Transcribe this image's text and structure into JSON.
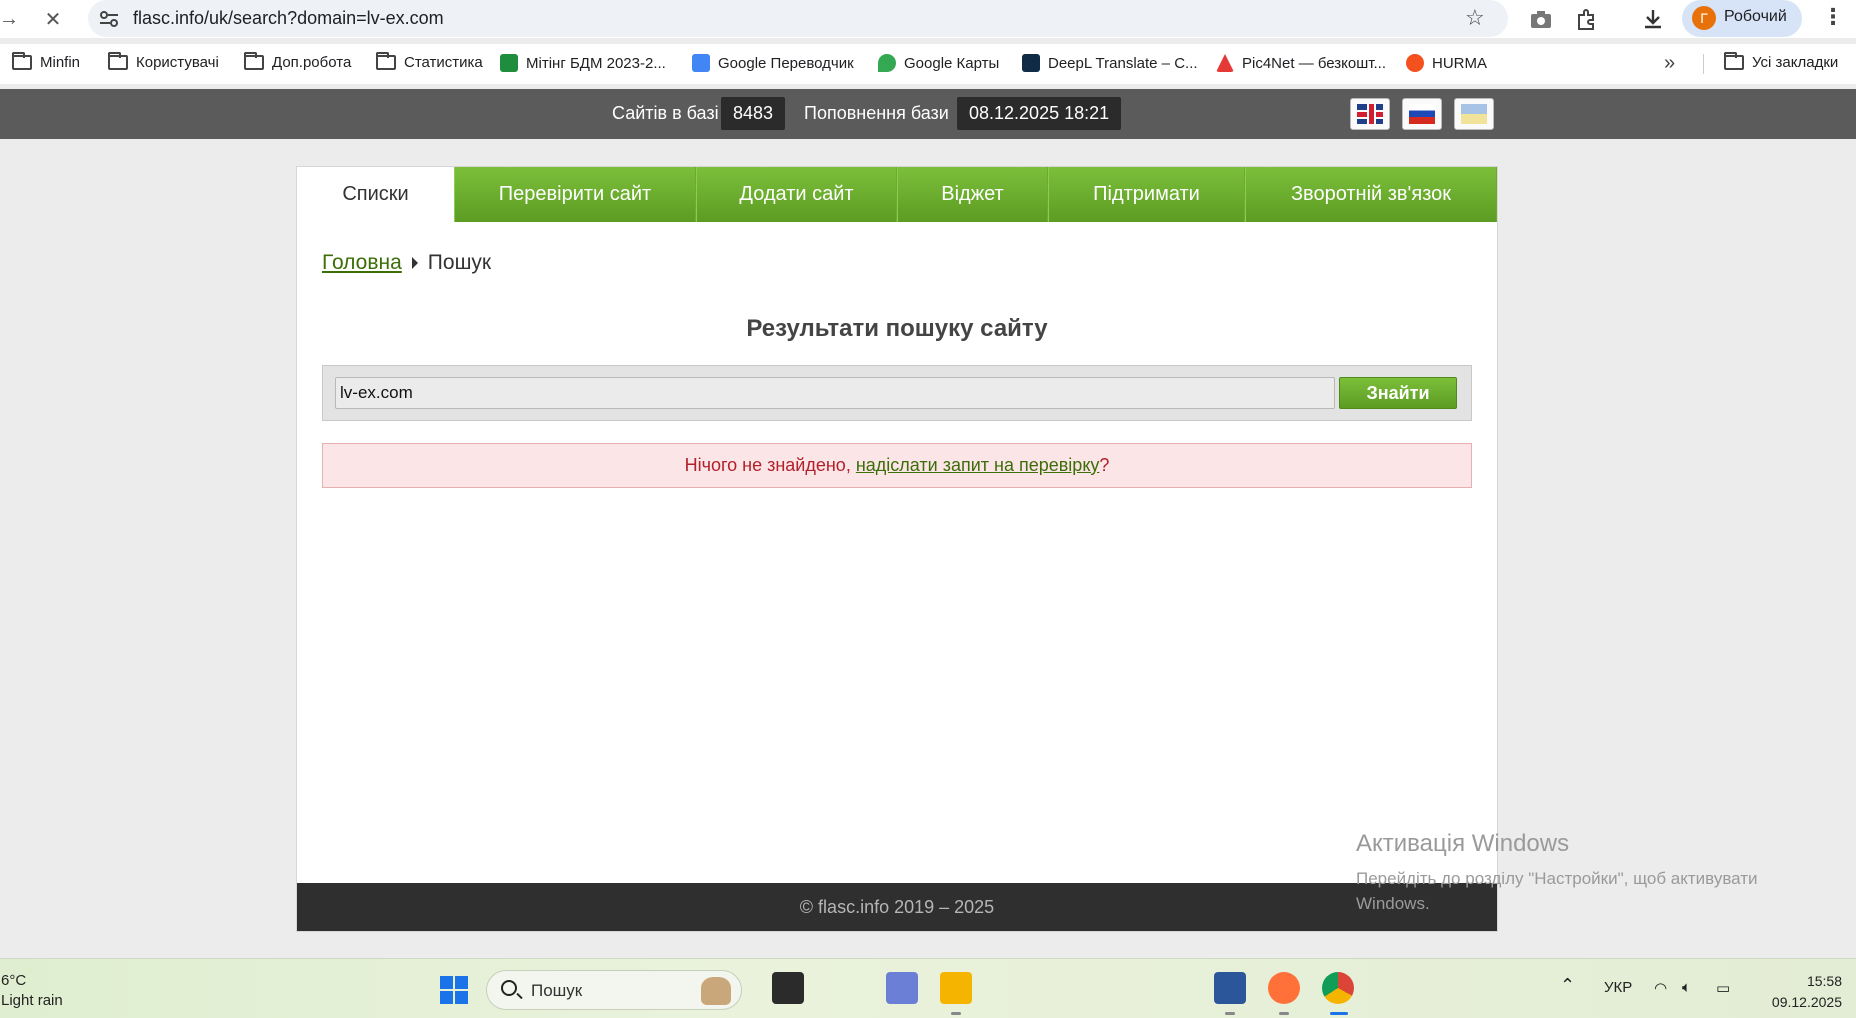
{
  "browser": {
    "url": "flasc.info/uk/search?domain=lv-ex.com",
    "profile_initial": "Г",
    "profile_name": "Робочий",
    "bookmarks": [
      {
        "label": "Minfin",
        "icon": "folder-icon"
      },
      {
        "label": "Користувачі",
        "icon": "folder-icon"
      },
      {
        "label": "Доп.робота",
        "icon": "folder-icon"
      },
      {
        "label": "Статистика",
        "icon": "folder-icon"
      },
      {
        "label": "Мітінг БДМ 2023-2...",
        "icon": "sheets-icon"
      },
      {
        "label": "Google Переводчик",
        "icon": "translate-icon"
      },
      {
        "label": "Google Карты",
        "icon": "maps-icon"
      },
      {
        "label": "DeepL Translate – С...",
        "icon": "deepl-icon"
      },
      {
        "label": "Pic4Net — безкошт...",
        "icon": "pic4net-icon"
      },
      {
        "label": "HURMA",
        "icon": "hurma-icon"
      }
    ],
    "all_bookmarks": "Усі закладки"
  },
  "site": {
    "stats": {
      "sites_label": "Сайтів в базі",
      "sites_count": "8483",
      "update_label": "Поповнення бази",
      "update_date": "08.12.2025 18:21"
    },
    "tabs": [
      {
        "label": "Списки",
        "active": true
      },
      {
        "label": "Перевірити сайт"
      },
      {
        "label": "Додати сайт"
      },
      {
        "label": "Віджет"
      },
      {
        "label": "Підтримати"
      },
      {
        "label": "Зворотній зв'язок"
      }
    ],
    "breadcrumb": {
      "home": "Головна",
      "current": "Пошук"
    },
    "title": "Результати пошуку сайту",
    "search": {
      "value": "lv-ex.com",
      "button": "Знайти"
    },
    "alert": {
      "prefix": "Нічого не знайдено, ",
      "link": "надіслати запит на перевірку",
      "suffix": "?"
    },
    "footer": "© flasc.info 2019 – 2025"
  },
  "watermark": {
    "title": "Активація Windows",
    "text": "Перейдіть до розділу \"Настройки\", щоб активувати Windows."
  },
  "taskbar": {
    "temp": "6°C",
    "weather": "Light rain",
    "search_label": "Пошук",
    "lang": "УКР",
    "time": "15:58",
    "date": "09.12.2025"
  },
  "colors": {
    "accent_green": "#6aad2c",
    "header_gray": "#5b5b5b",
    "alert_red": "#b0212b"
  }
}
